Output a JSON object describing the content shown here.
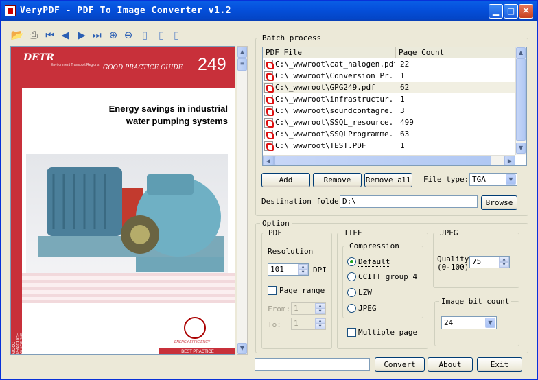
{
  "window": {
    "title": "VeryPDF - PDF To Image Converter v1.2",
    "controls": [
      "minimize",
      "maximize",
      "close"
    ]
  },
  "toolbar": {
    "icons": [
      "open-folder-icon",
      "print-icon",
      "first-page-icon",
      "prev-page-icon",
      "next-page-icon",
      "last-page-icon",
      "zoom-in-icon",
      "zoom-out-icon",
      "fit-page-icon",
      "fit-width-icon",
      "actual-size-icon"
    ]
  },
  "preview": {
    "logo": "DETR",
    "logo_sub": "Environment Transport Regions",
    "guide": "GOOD PRACTICE GUIDE",
    "number": "249",
    "title_line1": "Energy savings in industrial",
    "title_line2": "water pumping systems",
    "side_text": "GOOD PRACTICE GUIDE 249",
    "badge_text": "ENERGY EFFICIENCY",
    "footer": "BEST PRACTICE"
  },
  "batch": {
    "legend": "Batch process",
    "columns": [
      "PDF File",
      "Page Count"
    ],
    "rows": [
      {
        "file": "C:\\_wwwroot\\cat_halogen.pdf",
        "count": "22"
      },
      {
        "file": "C:\\_wwwroot\\Conversion Pr...",
        "count": "1"
      },
      {
        "file": "C:\\_wwwroot\\GPG249.pdf",
        "count": "62",
        "selected": true
      },
      {
        "file": "C:\\_wwwroot\\infrastructur...",
        "count": "1"
      },
      {
        "file": "C:\\_wwwroot\\soundcontagre...",
        "count": "3"
      },
      {
        "file": "C:\\_wwwroot\\SSQL_resource...",
        "count": "499"
      },
      {
        "file": "C:\\_wwwroot\\SSQLProgramme...",
        "count": "63"
      },
      {
        "file": "C:\\_wwwroot\\TEST.PDF",
        "count": "1"
      }
    ],
    "add": "Add",
    "remove": "Remove",
    "remove_all": "Remove all",
    "file_type_label": "File type:",
    "file_type": "TGA",
    "dest_label": "Destination folder",
    "dest_value": "D:\\",
    "browse": "Browse"
  },
  "option": {
    "legend": "Option",
    "pdf": {
      "legend": "PDF",
      "resolution_label": "Resolution",
      "resolution": "101",
      "dpi": "DPI",
      "page_range": "Page range",
      "from_label": "From:",
      "from": "1",
      "to_label": "To:",
      "to": "1"
    },
    "tiff": {
      "legend": "TIFF",
      "compression_legend": "Compression",
      "options": [
        "Default",
        "CCITT group 4",
        "LZW",
        "JPEG"
      ],
      "selected": "Default",
      "multiple_page": "Multiple page"
    },
    "jpeg": {
      "legend": "JPEG",
      "quality_label_1": "Quality",
      "quality_label_2": "(0-100)",
      "quality": "75"
    },
    "bitcount": {
      "legend": "Image bit count",
      "value": "24"
    }
  },
  "footer": {
    "convert": "Convert",
    "about": "About",
    "exit": "Exit"
  },
  "colors": {
    "titlebar": "#0550dc",
    "window_bg": "#ece9d8",
    "doc_red": "#c8303a"
  }
}
